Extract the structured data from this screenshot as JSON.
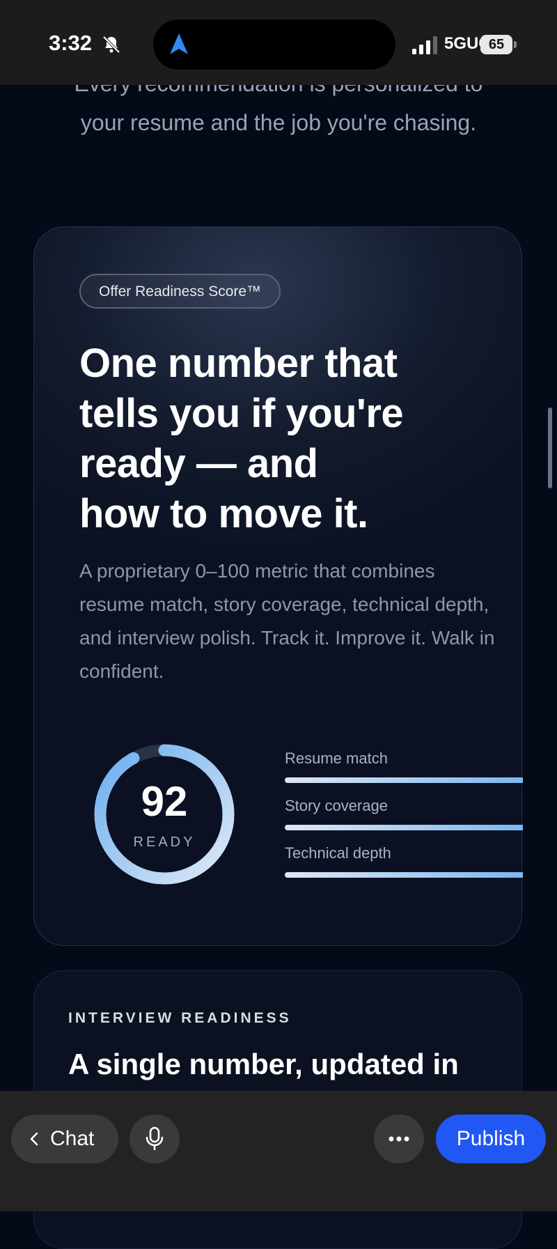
{
  "status_bar": {
    "time": "3:32",
    "network": "5GUC",
    "battery": "65",
    "icons": [
      "bell-slash-icon",
      "location-arrow-icon",
      "signal-icon",
      "battery-icon"
    ]
  },
  "intro": {
    "line_partial": "Every recommendation is personalized to",
    "line2": "your resume and the job you're chasing."
  },
  "score_card": {
    "badge": "Offer Readiness Score™",
    "headline": [
      "One number that",
      "tells you if you're",
      "ready — and",
      "how to move it."
    ],
    "description": "A proprietary 0–100 metric that combines resume match, story coverage, technical depth, and interview polish. Track it. Improve it. Walk in confident.",
    "score": {
      "value": "92",
      "label": "READY",
      "fraction": 0.92
    },
    "metrics": [
      {
        "label": "Resume match"
      },
      {
        "label": "Story coverage"
      },
      {
        "label": "Technical depth"
      }
    ]
  },
  "readiness_card": {
    "eyebrow": "INTERVIEW READINESS",
    "title_partial": "A single number, updated in"
  },
  "toolbar": {
    "chat_label": "Chat",
    "publish_label": "Publish"
  },
  "colors": {
    "background": "#050a18",
    "accent_blue": "#2157f3",
    "gauge_light": "#dfe9f7",
    "gauge_blue": "#6aaeef"
  }
}
